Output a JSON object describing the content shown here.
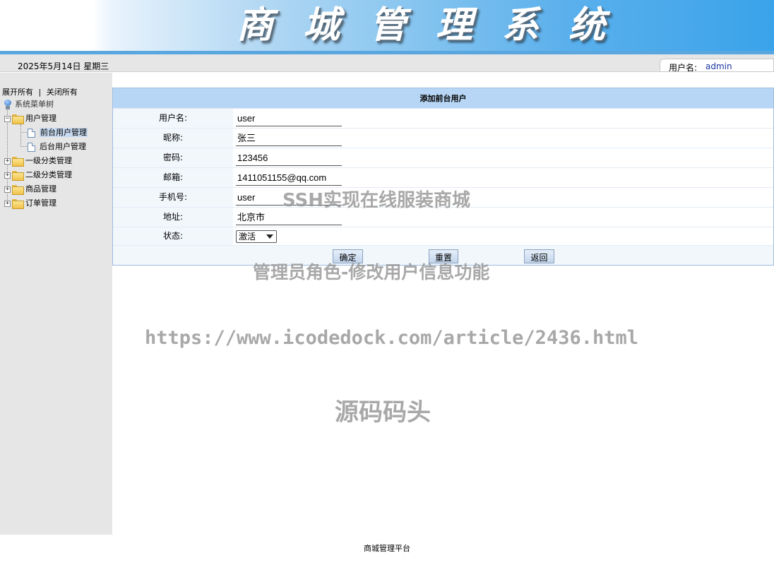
{
  "header": {
    "title": "商城管理系统"
  },
  "infobar": {
    "date": "2025年5月14日 星期三",
    "user_label": "用户名:",
    "user_value": "admin"
  },
  "sidebar": {
    "expand_all": "展开所有",
    "separator": "|",
    "collapse_all": "关闭所有",
    "root_label": "系统菜单树",
    "items": [
      {
        "label": "用户管理",
        "icon": "folder-open-icon",
        "expanded": true,
        "children": [
          {
            "label": "前台用户管理",
            "selected": true
          },
          {
            "label": "后台用户管理",
            "selected": false
          }
        ]
      },
      {
        "label": "一级分类管理",
        "icon": "folder-icon"
      },
      {
        "label": "二级分类管理",
        "icon": "folder-icon"
      },
      {
        "label": "商品管理",
        "icon": "folder-icon"
      },
      {
        "label": "订单管理",
        "icon": "folder-icon"
      }
    ]
  },
  "form": {
    "title": "添加前台用户",
    "fields": [
      {
        "label": "用户名:",
        "value": "user"
      },
      {
        "label": "昵称:",
        "value": "张三"
      },
      {
        "label": "密码:",
        "value": "123456"
      },
      {
        "label": "邮箱:",
        "value": "1411051155@qq.com"
      },
      {
        "label": "手机号:",
        "value": "user"
      },
      {
        "label": "地址:",
        "value": "北京市"
      }
    ],
    "status": {
      "label": "状态:",
      "selected": "激活"
    },
    "buttons": {
      "confirm": "确定",
      "reset": "重置",
      "back": "返回"
    }
  },
  "watermarks": {
    "line1": "SSH实现在线服装商城",
    "line2": "管理员角色-修改用户信息功能",
    "line3": "https://www.icodedock.com/article/2436.html",
    "line4": "源码码头"
  },
  "footer": {
    "text": "商城管理平台"
  },
  "colors": {
    "header_accent": "#3aa3ea",
    "form_title_bg": "#b7d6f5",
    "sidebar_bg": "#e6e6e6"
  }
}
